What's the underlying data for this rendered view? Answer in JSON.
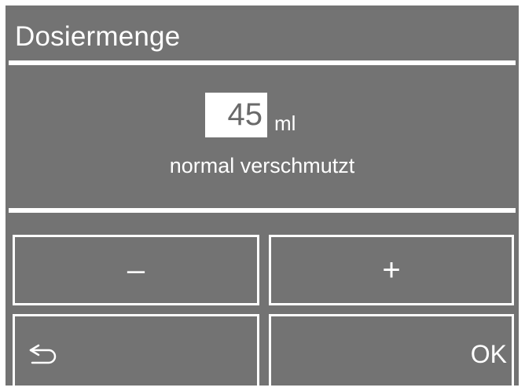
{
  "header": {
    "title": "Dosiermenge"
  },
  "dosage": {
    "value": "45",
    "unit": "ml",
    "description": "normal verschmutzt"
  },
  "buttons": {
    "minus_label": "–",
    "plus_label": "+",
    "back_icon": "return-arrow-icon",
    "ok_label": "OK"
  },
  "colors": {
    "background": "#737373",
    "foreground": "#ffffff",
    "value_text": "#6a6a6a"
  }
}
